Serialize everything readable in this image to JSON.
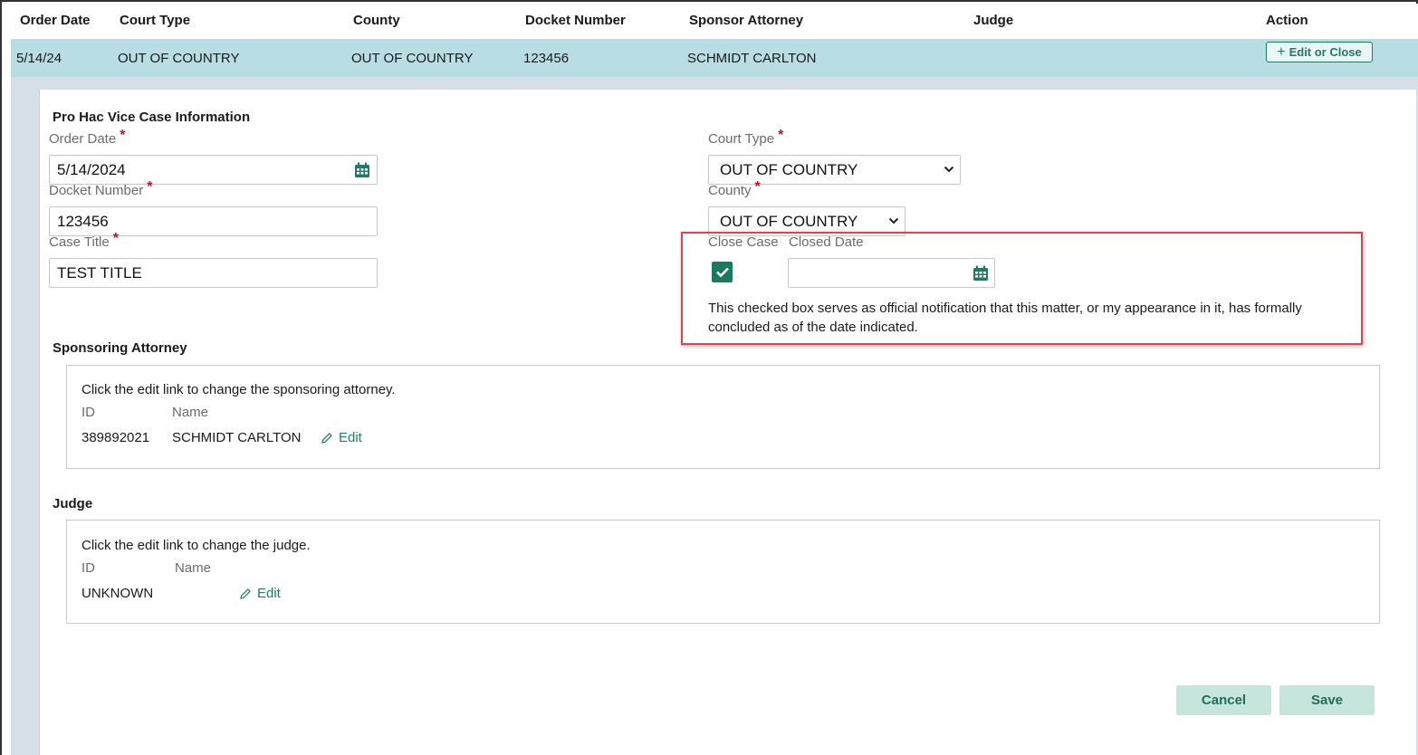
{
  "table": {
    "headers": {
      "order_date": "Order Date",
      "court_type": "Court Type",
      "county": "County",
      "docket_number": "Docket Number",
      "sponsor_attorney": "Sponsor Attorney",
      "judge": "Judge",
      "action": "Action"
    },
    "row": {
      "order_date": "5/14/24",
      "court_type": "OUT OF COUNTRY",
      "county": "OUT OF COUNTRY",
      "docket_number": "123456",
      "sponsor_attorney": "SCHMIDT CARLTON",
      "judge": "",
      "action_label": "Edit or Close"
    }
  },
  "form": {
    "section_title": "Pro Hac Vice Case Information",
    "order_date": {
      "label": "Order Date",
      "value": "5/14/2024"
    },
    "docket_number": {
      "label": "Docket Number",
      "value": "123456"
    },
    "case_title": {
      "label": "Case Title",
      "value": "TEST TITLE"
    },
    "court_type": {
      "label": "Court Type",
      "value": "OUT OF COUNTRY"
    },
    "county": {
      "label": "County",
      "value": "OUT OF COUNTRY"
    },
    "close_case": {
      "label": "Close Case",
      "checked": true
    },
    "closed_date": {
      "label": "Closed Date",
      "value": ""
    },
    "required_marker": "*",
    "notice": "This checked box serves as official notification that this matter, or my appearance in it, has formally concluded as of the date indicated."
  },
  "sponsoring_attorney": {
    "title": "Sponsoring Attorney",
    "instruction": "Click the edit link to change the sponsoring attorney.",
    "id_label": "ID",
    "name_label": "Name",
    "id": "389892021",
    "name": "SCHMIDT CARLTON",
    "edit_label": "Edit"
  },
  "judge": {
    "title": "Judge",
    "instruction": "Click the edit link to change the judge.",
    "id_label": "ID",
    "name_label": "Name",
    "id": "UNKNOWN",
    "name": "",
    "edit_label": "Edit"
  },
  "buttons": {
    "cancel": "Cancel",
    "save": "Save"
  },
  "colors": {
    "accent": "#1e7b67",
    "row_highlight": "#b8dde3",
    "required": "#c0122c",
    "callout": "#e0434b",
    "checkbox": "#1a7a5e"
  },
  "icons": {
    "calendar": "calendar-icon",
    "chevron": "chevron-down-icon",
    "pencil": "pencil-icon",
    "plus": "plus-icon",
    "check": "check-icon"
  }
}
